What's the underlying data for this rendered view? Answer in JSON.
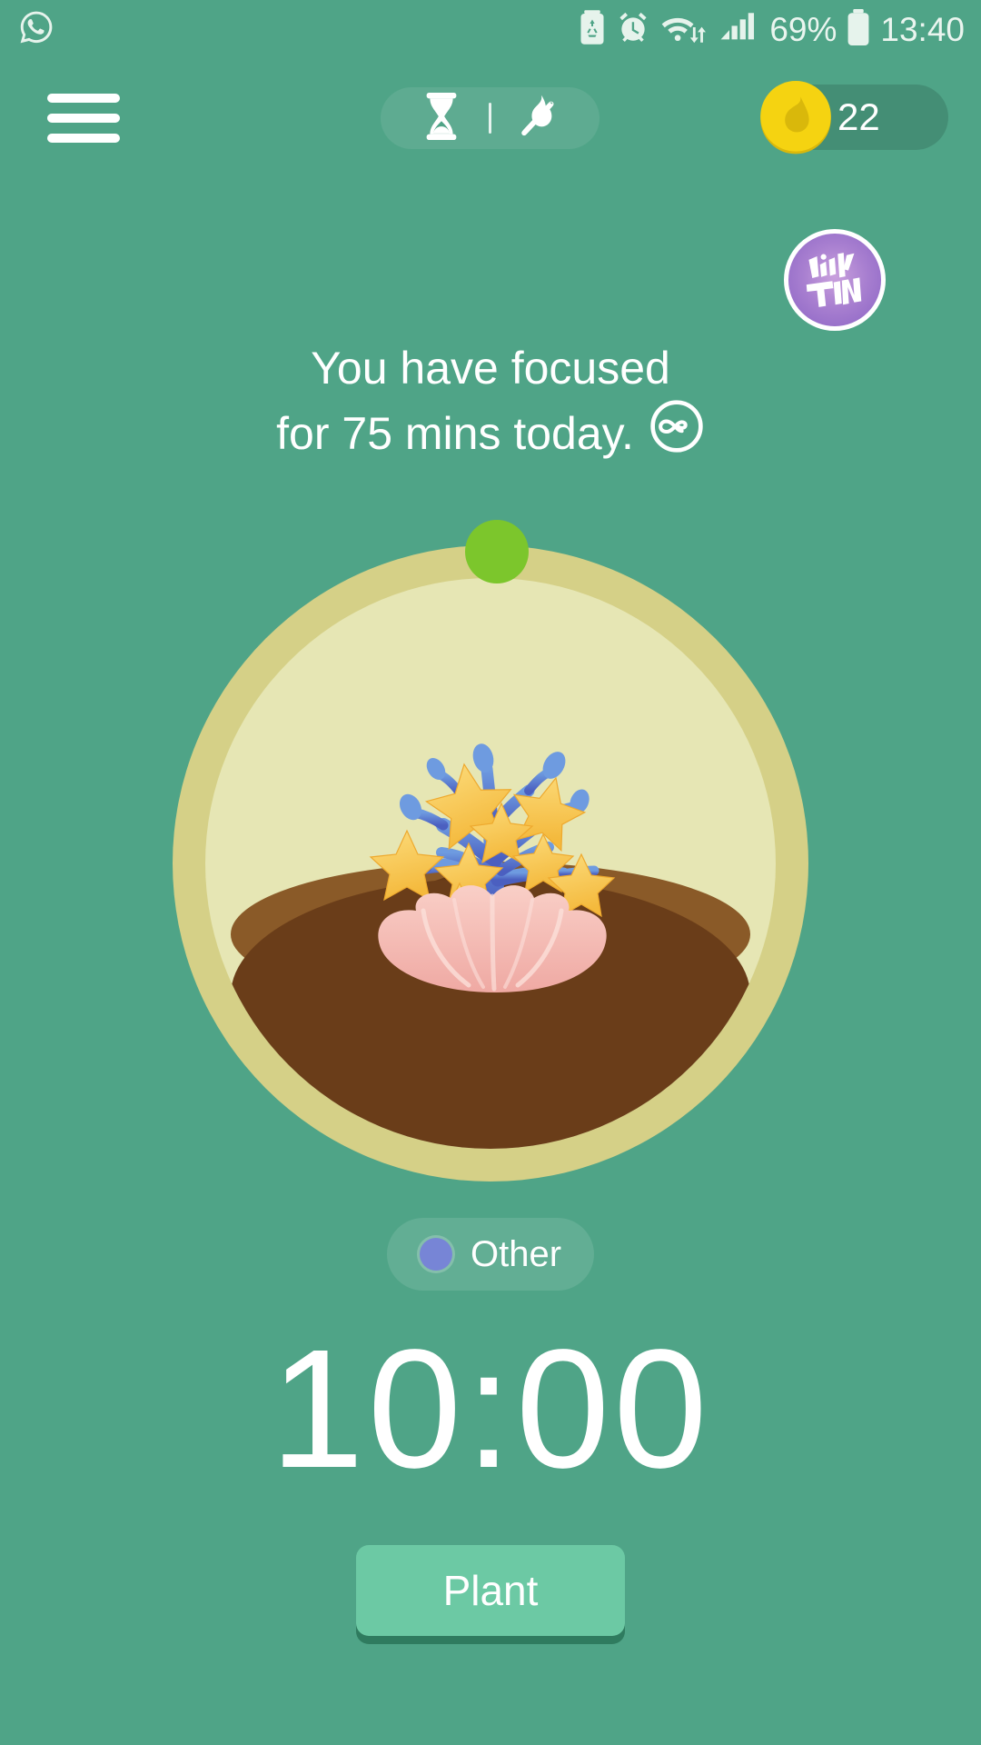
{
  "theme": {
    "background": "#4FA487",
    "accent_button": "#6CC9A4",
    "button_shadow": "#2F7B5F",
    "pot_ring": "#D5D087",
    "pot_inner": "#E6E6B4",
    "soil_top": "#8A5A28",
    "soil_body": "#6A3D19",
    "progress_dot": "#7CC62C",
    "coin": "#F5D311",
    "tag_dot": "#7785D6",
    "avatar": "#8A63C4"
  },
  "status_bar": {
    "notification_icon": "whatsapp-icon",
    "icons": [
      "battery-saver-icon",
      "alarm-clock-icon",
      "wifi-icon",
      "cellular-signal-icon"
    ],
    "battery_percent": "69%",
    "battery_icon": "battery-icon",
    "clock": "13:40"
  },
  "top_bar": {
    "menu_icon": "hamburger-menu-icon",
    "mode_toggle": {
      "timer_icon": "hourglass-icon",
      "deep_focus_icon": "flame-off-icon"
    },
    "coins": {
      "icon": "coin-icon",
      "count": "22"
    },
    "avatar": {
      "icon": "tinytan-avatar-icon",
      "label": "TINY TAN"
    }
  },
  "focus_summary": {
    "line1": "You have focused",
    "line2": "for 75 mins today.",
    "infinity_icon": "infinity-circle-icon",
    "minutes": 75
  },
  "plant": {
    "species": "coral-star-plant",
    "pot_icon": "plant-pot-icon",
    "progress_dot_icon": "progress-dot-icon"
  },
  "tag": {
    "dot_color": "#7785D6",
    "label": "Other"
  },
  "timer": {
    "value": "10:00",
    "minutes": 10,
    "seconds": 0
  },
  "actions": {
    "plant_label": "Plant"
  }
}
